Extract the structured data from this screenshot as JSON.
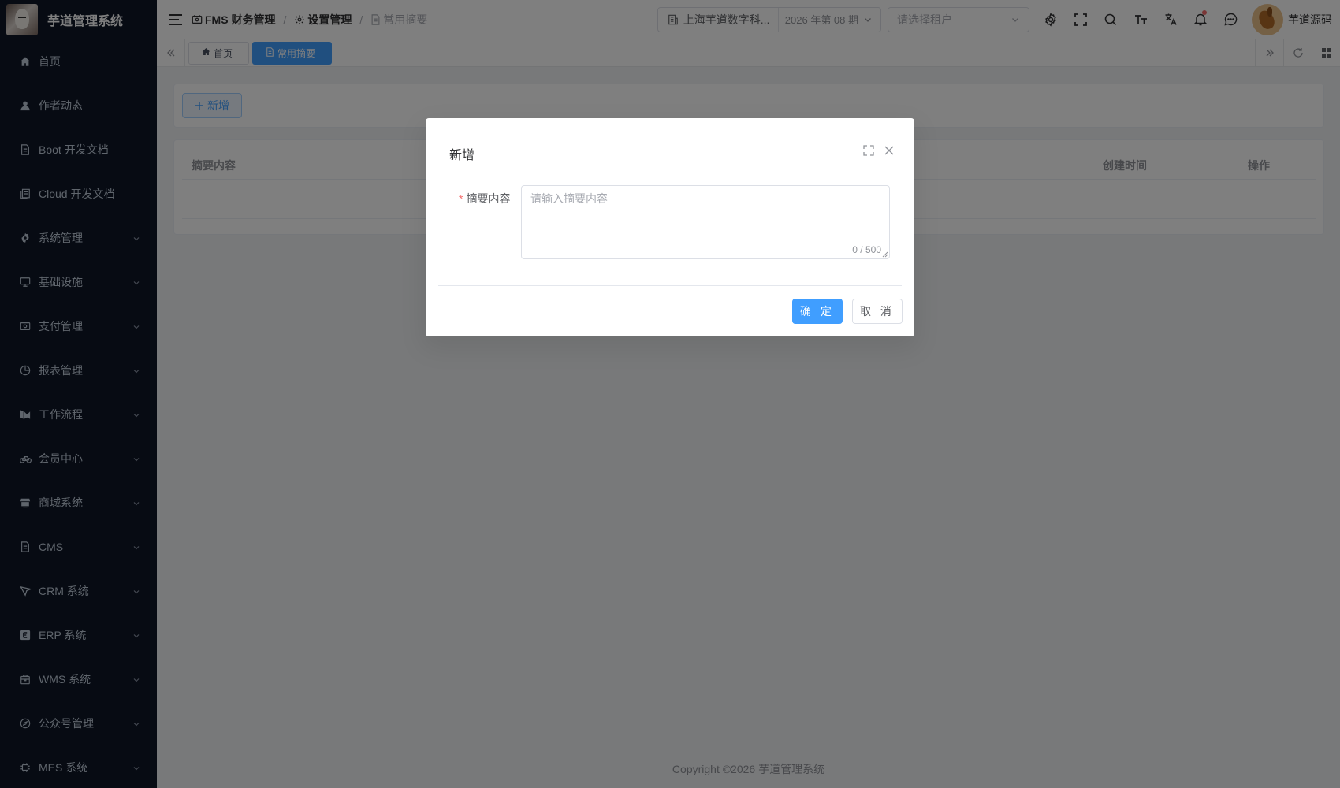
{
  "app": {
    "title": "芋道管理系统"
  },
  "sidebar": {
    "items": [
      {
        "label": "首页",
        "icon": "home-icon",
        "expandable": false
      },
      {
        "label": "作者动态",
        "icon": "user-icon",
        "expandable": false
      },
      {
        "label": "Boot 开发文档",
        "icon": "document-icon",
        "expandable": false
      },
      {
        "label": "Cloud 开发文档",
        "icon": "documents-icon",
        "expandable": false
      },
      {
        "label": "系统管理",
        "icon": "gear-icon",
        "expandable": true
      },
      {
        "label": "基础设施",
        "icon": "monitor-icon",
        "expandable": true
      },
      {
        "label": "支付管理",
        "icon": "payment-icon",
        "expandable": true
      },
      {
        "label": "报表管理",
        "icon": "pie-chart-icon",
        "expandable": true
      },
      {
        "label": "工作流程",
        "icon": "workflow-icon",
        "expandable": true
      },
      {
        "label": "会员中心",
        "icon": "bicycle-icon",
        "expandable": true
      },
      {
        "label": "商城系统",
        "icon": "shop-icon",
        "expandable": true
      },
      {
        "label": "CMS",
        "icon": "document-icon",
        "expandable": true
      },
      {
        "label": "CRM 系统",
        "icon": "crm-icon",
        "expandable": true
      },
      {
        "label": "ERP 系统",
        "icon": "erp-icon",
        "expandable": true
      },
      {
        "label": "WMS 系统",
        "icon": "warehouse-icon",
        "expandable": true
      },
      {
        "label": "公众号管理",
        "icon": "compass-icon",
        "expandable": true
      },
      {
        "label": "MES 系统",
        "icon": "cpu-icon",
        "expandable": true
      }
    ]
  },
  "header": {
    "breadcrumb": [
      {
        "label": "FMS 财务管理",
        "icon": "finance-icon"
      },
      {
        "label": "设置管理",
        "icon": "gear-icon"
      },
      {
        "label": "常用摘要",
        "icon": "document-icon"
      }
    ],
    "org_name": "上海芋道数字科...",
    "period": "2026 年第 08 期",
    "tenant_placeholder": "请选择租户",
    "user_name": "芋道源码"
  },
  "tags": [
    {
      "label": "首页",
      "active": false
    },
    {
      "label": "常用摘要",
      "active": true
    }
  ],
  "main": {
    "add_button": "新增",
    "table_headers": {
      "content": "摘要内容",
      "created_at": "创建时间",
      "actions": "操作"
    },
    "footer": "Copyright ©2026 芋道管理系统"
  },
  "dialog": {
    "title": "新增",
    "field_label": "摘要内容",
    "placeholder": "请输入摘要内容",
    "value": "",
    "counter": "0 / 500",
    "confirm": "确 定",
    "cancel": "取 消"
  },
  "colors": {
    "primary": "#409eff",
    "sidebar_bg": "#0f1727",
    "required": "#f56c6c"
  }
}
